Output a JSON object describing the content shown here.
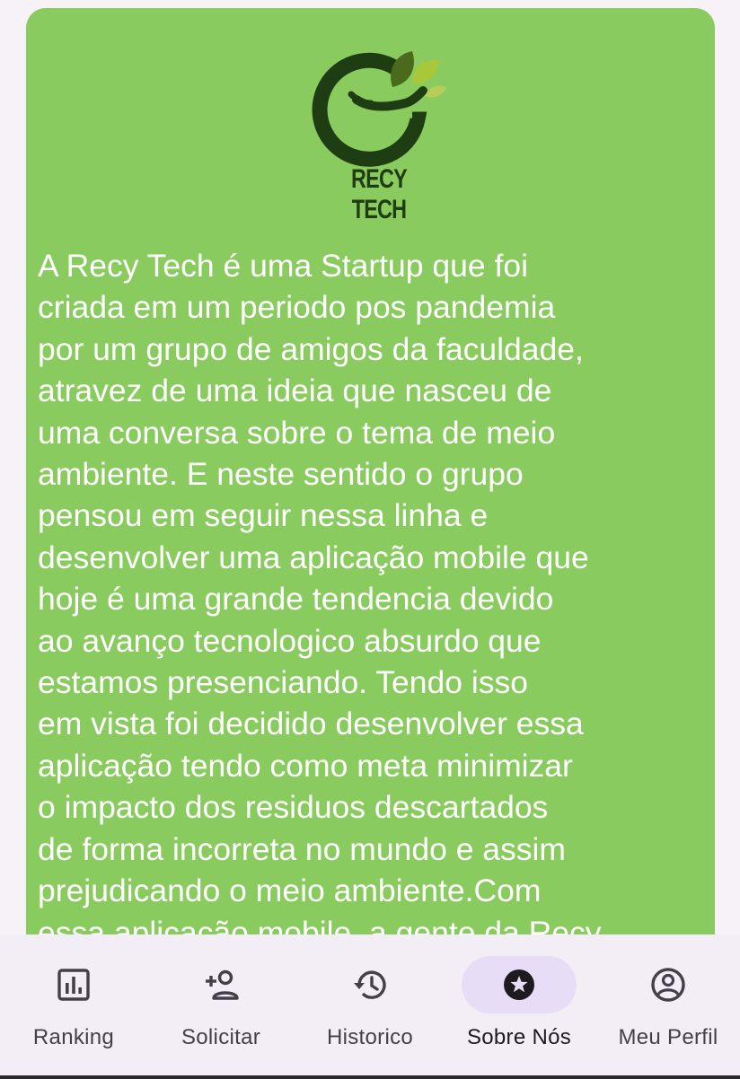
{
  "brand": {
    "name": "RECY TECH",
    "colors": {
      "card_background": "#8acb5f",
      "logo_dark_green": "#1f3d12",
      "logo_leaf_light": "#a7c939",
      "nav_background": "#f3edf5",
      "nav_active_pill": "#e8ddf7"
    }
  },
  "about": {
    "paragraph": "  A Recy Tech é uma Startup que foi\ncriada em um periodo pos pandemia\npor um grupo de amigos da faculdade,\natravez de uma ideia que nasceu de\numa conversa sobre o tema de meio\nambiente. E neste sentido o grupo\npensou em seguir nessa linha e\ndesenvolver uma aplicação mobile que\nhoje é uma grande tendencia devido\nao avanço tecnologico absurdo que\nestamos presenciando. Tendo isso\nem vista foi decidido desenvolver essa\naplicação tendo como meta minimizar\no impacto dos residuos descartados\nde forma incorreta no mundo e assim\nprejudicando o meio ambiente.Com\nessa aplicação mobile, a gente da Recy"
  },
  "nav": {
    "items": [
      {
        "label": "Ranking",
        "icon": "bar-chart-icon",
        "active": false
      },
      {
        "label": "Solicitar",
        "icon": "person-add-icon",
        "active": false
      },
      {
        "label": "Historico",
        "icon": "history-icon",
        "active": false
      },
      {
        "label": "Sobre Nós",
        "icon": "star-circle-icon",
        "active": true
      },
      {
        "label": "Meu Perfil",
        "icon": "account-circle-icon",
        "active": false
      }
    ]
  }
}
